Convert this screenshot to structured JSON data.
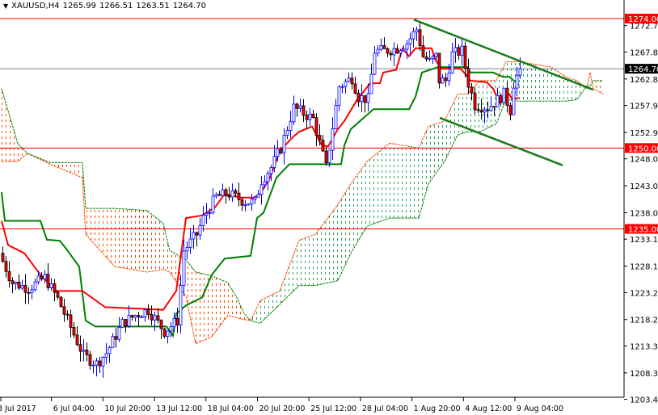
{
  "header": {
    "symbol": "XAUUSD,H4",
    "open": "1265.99",
    "high": "1266.51",
    "low": "1263.51",
    "close": "1264.70",
    "menu_icon": "triangle-down-icon"
  },
  "colors": {
    "bull": "#0000ff",
    "bear": "#ff0000",
    "tenkan": "#ff0000",
    "kijun": "#008000",
    "cloud_up": "#2e9e5e",
    "cloud_down": "#ff4500",
    "trendline": "#1a7a1a",
    "level": "#ff0000",
    "price_line": "#778899"
  },
  "chart_data": {
    "type": "candlestick",
    "title": "XAUUSD,H4",
    "ylim": [
      1203.4,
      1274.0
    ],
    "y_ticks": [
      "1272.70",
      "1267.80",
      "1262.80",
      "1257.90",
      "1252.90",
      "1248.00",
      "1243.00",
      "1238.00",
      "1233.10",
      "1228.10",
      "1223.20",
      "1218.20",
      "1213.30",
      "1208.30",
      "1203.40"
    ],
    "x_ticks": [
      {
        "label": "3 Jul 2017",
        "bar": 0
      },
      {
        "label": "6 Jul 04:00",
        "bar": 16
      },
      {
        "label": "10 Jul 20:00",
        "bar": 32
      },
      {
        "label": "13 Jul 12:00",
        "bar": 48
      },
      {
        "label": "18 Jul 04:00",
        "bar": 64
      },
      {
        "label": "20 Jul 20:00",
        "bar": 80
      },
      {
        "label": "25 Jul 12:00",
        "bar": 96
      },
      {
        "label": "28 Jul 04:00",
        "bar": 112
      },
      {
        "label": "1 Aug 20:00",
        "bar": 128
      },
      {
        "label": "4 Aug 12:00",
        "bar": 144
      },
      {
        "label": "9 Aug 04:00",
        "bar": 160
      }
    ],
    "horizontal_levels": [
      {
        "label": "1274.00",
        "value": 1274.0
      },
      {
        "label": "1250.00",
        "value": 1250.0
      },
      {
        "label": "1235.00",
        "value": 1235.0
      }
    ],
    "current_price": {
      "label": "1264.70",
      "value": 1264.7
    },
    "close_keypoints": [
      [
        0,
        1229
      ],
      [
        3,
        1225
      ],
      [
        8,
        1224
      ],
      [
        13,
        1226
      ],
      [
        17,
        1222
      ],
      [
        25,
        1211.5
      ],
      [
        29,
        1210
      ],
      [
        32,
        1212
      ],
      [
        37,
        1217.5
      ],
      [
        41,
        1219
      ],
      [
        45,
        1220
      ],
      [
        50,
        1216
      ],
      [
        54,
        1218
      ],
      [
        56,
        1231
      ],
      [
        60,
        1234
      ],
      [
        62,
        1237
      ],
      [
        66,
        1241
      ],
      [
        70,
        1241.5
      ],
      [
        75,
        1240
      ],
      [
        78,
        1240
      ],
      [
        80,
        1244
      ],
      [
        83,
        1246.4
      ],
      [
        86,
        1250
      ],
      [
        90,
        1257.5
      ],
      [
        96,
        1255.4
      ],
      [
        100,
        1246.4
      ],
      [
        104,
        1261.4
      ],
      [
        108,
        1263
      ],
      [
        110,
        1259.5
      ],
      [
        113,
        1259
      ],
      [
        115,
        1268
      ],
      [
        118,
        1268
      ],
      [
        122,
        1268.5
      ],
      [
        125,
        1269.5
      ],
      [
        128,
        1272
      ],
      [
        130,
        1267
      ],
      [
        132,
        1266
      ],
      [
        134,
        1267
      ],
      [
        135,
        1262.5
      ],
      [
        137,
        1262.5
      ],
      [
        139,
        1267.4
      ],
      [
        142,
        1268
      ],
      [
        144,
        1262
      ],
      [
        146,
        1258
      ],
      [
        150,
        1257.5
      ],
      [
        152,
        1258.4
      ],
      [
        155,
        1260
      ],
      [
        157,
        1257
      ],
      [
        158,
        1262
      ],
      [
        160,
        1264.7
      ]
    ],
    "tenkan_sen": [
      [
        0,
        1236.5
      ],
      [
        2,
        1232
      ],
      [
        7,
        1230.5
      ],
      [
        12,
        1226.5
      ],
      [
        17,
        1223.5
      ],
      [
        25,
        1223.5
      ],
      [
        32,
        1220.5
      ],
      [
        50,
        1220
      ],
      [
        54,
        1223.5
      ],
      [
        57,
        1237
      ],
      [
        62,
        1237.5
      ],
      [
        66,
        1239
      ],
      [
        69,
        1241.5
      ],
      [
        74,
        1240.8
      ],
      [
        78,
        1240.8
      ],
      [
        80,
        1241.5
      ],
      [
        83,
        1244.5
      ],
      [
        86,
        1249.4
      ],
      [
        90,
        1252
      ],
      [
        92,
        1253
      ],
      [
        96,
        1254
      ],
      [
        99,
        1250.5
      ],
      [
        101,
        1250.3
      ],
      [
        104,
        1253.5
      ],
      [
        106,
        1255
      ],
      [
        110,
        1259
      ],
      [
        114,
        1262
      ],
      [
        117,
        1262
      ],
      [
        118,
        1264
      ],
      [
        122,
        1264.5
      ],
      [
        124,
        1268.5
      ],
      [
        126,
        1267
      ],
      [
        128,
        1268.5
      ],
      [
        133,
        1268.5
      ],
      [
        134,
        1266.5
      ],
      [
        136,
        1264.7
      ],
      [
        142,
        1264.7
      ],
      [
        143,
        1264
      ],
      [
        145,
        1262.5
      ],
      [
        150,
        1262.2
      ],
      [
        152,
        1261
      ],
      [
        154,
        1258.4
      ],
      [
        157,
        1260
      ],
      [
        158,
        1259
      ],
      [
        160,
        1259.3
      ]
    ],
    "kijun_sen": [
      [
        0,
        1241.8
      ],
      [
        1,
        1236.5
      ],
      [
        12,
        1236.5
      ],
      [
        14,
        1233
      ],
      [
        18,
        1232.8
      ],
      [
        20,
        1231.3
      ],
      [
        24,
        1228
      ],
      [
        26,
        1218
      ],
      [
        29,
        1216.9
      ],
      [
        51,
        1216.9
      ],
      [
        53,
        1215.2
      ],
      [
        54,
        1219.3
      ],
      [
        57,
        1220.8
      ],
      [
        62,
        1222.3
      ],
      [
        65,
        1226.5
      ],
      [
        69,
        1229.5
      ],
      [
        77,
        1230
      ],
      [
        79,
        1237
      ],
      [
        81,
        1238
      ],
      [
        85,
        1244.5
      ],
      [
        89,
        1247
      ],
      [
        105,
        1247
      ],
      [
        106,
        1250.5
      ],
      [
        108,
        1253.5
      ],
      [
        115,
        1257.2
      ],
      [
        126,
        1257.2
      ],
      [
        128,
        1259.5
      ],
      [
        130,
        1264
      ],
      [
        135,
        1265
      ],
      [
        144,
        1265
      ],
      [
        145,
        1264
      ],
      [
        152,
        1264
      ],
      [
        155,
        1263.2
      ],
      [
        157,
        1263.2
      ],
      [
        160,
        1261.7
      ]
    ],
    "cloud": [
      [
        0,
        1247.5,
        1261
      ],
      [
        5,
        1247.5,
        1250.8
      ],
      [
        8,
        1249,
        1249
      ],
      [
        15,
        1247,
        1247.3
      ],
      [
        25,
        1244.5,
        1247.3
      ],
      [
        26,
        1234,
        1238.8
      ],
      [
        35,
        1228,
        1238.8
      ],
      [
        45,
        1227,
        1238.4
      ],
      [
        50,
        1227.5,
        1236
      ],
      [
        52,
        1227,
        1231
      ],
      [
        57,
        1222.5,
        1229.3
      ],
      [
        60,
        1213.7,
        1227
      ],
      [
        65,
        1215,
        1226.3
      ],
      [
        70,
        1219,
        1225
      ],
      [
        73,
        1218.5,
        1222
      ],
      [
        75,
        1218.2,
        1219.3
      ],
      [
        77,
        1218,
        1218
      ],
      [
        80,
        1221.7,
        1217.5
      ],
      [
        86,
        1223.5,
        1221
      ],
      [
        92,
        1232.9,
        1224.5
      ],
      [
        97,
        1234,
        1224.5
      ],
      [
        104,
        1239.5,
        1225.4
      ],
      [
        108,
        1243.4,
        1230.5
      ],
      [
        113,
        1247.5,
        1235.5
      ],
      [
        120,
        1250.9,
        1237
      ],
      [
        129,
        1250,
        1237
      ],
      [
        132,
        1254,
        1243.4
      ],
      [
        137,
        1255,
        1247.5
      ],
      [
        141,
        1260,
        1252.4
      ],
      [
        144,
        1260,
        1253
      ],
      [
        148,
        1262.5,
        1253
      ],
      [
        153,
        1262.5,
        1254.5
      ],
      [
        156,
        1266,
        1259
      ],
      [
        160,
        1266,
        1258.7
      ],
      [
        170,
        1265,
        1258.7
      ],
      [
        175,
        1263,
        1258.7
      ],
      [
        178,
        1262.5,
        1259
      ],
      [
        181,
        1261,
        1261.5
      ],
      [
        182,
        1264,
        1261.5
      ],
      [
        183,
        1261,
        1262.5
      ],
      [
        186,
        1260,
        1262.5
      ]
    ],
    "trendlines": [
      {
        "name": "upper-trendline",
        "from": [
          127.5,
          1273.8
        ],
        "to": [
          183,
          1260.8
        ]
      },
      {
        "name": "lower-trendline",
        "from": [
          135.5,
          1255.6
        ],
        "to": [
          173.5,
          1246.8
        ]
      }
    ]
  }
}
